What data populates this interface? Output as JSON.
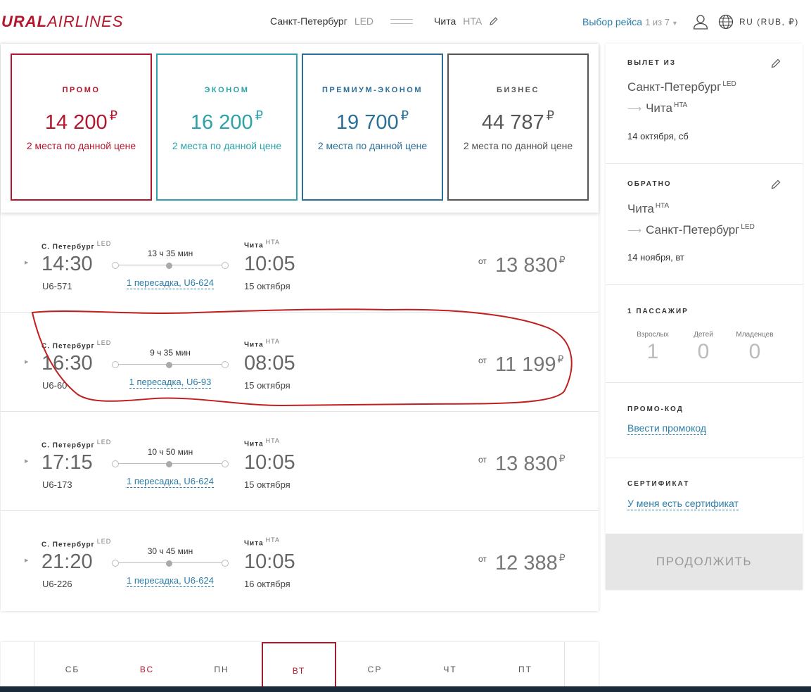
{
  "header": {
    "logo_bold": "URAL",
    "logo_light": "AIRLINES",
    "from_city": "Санкт-Петербург",
    "from_code": "LED",
    "to_city": "Чита",
    "to_code": "HTA",
    "step_label": "Выбор рейса",
    "step_count": "1 из 7",
    "language": "RU (RUB, ₽)"
  },
  "fares": [
    {
      "name": "ПРОМО",
      "price": "14 200",
      "currency": "₽",
      "seats": "2 места по данной цене",
      "color": "#b3172d"
    },
    {
      "name": "ЭКОНОМ",
      "price": "16 200",
      "currency": "₽",
      "seats": "2 места по данной цене",
      "color": "#2da3a9"
    },
    {
      "name": "ПРЕМИУМ-ЭКОНОМ",
      "price": "19 700",
      "currency": "₽",
      "seats": "2 места по данной цене",
      "color": "#2a6f98"
    },
    {
      "name": "БИЗНЕС",
      "price": "44 787",
      "currency": "₽",
      "seats": "2 места по данной цене",
      "color": "#555555"
    }
  ],
  "flights": [
    {
      "from": "С. Петербург",
      "from_code": "LED",
      "dep": "14:30",
      "number": "U6-571",
      "duration": "13 ч 35 мин",
      "transfer": "1 пересадка, U6-624",
      "to": "Чита",
      "to_code": "HTA",
      "arr": "10:05",
      "arr_date": "15 октября",
      "from_label": "от",
      "price": "13 830",
      "currency": "₽"
    },
    {
      "from": "С. Петербург",
      "from_code": "LED",
      "dep": "16:30",
      "number": "U6-60",
      "duration": "9 ч 35 мин",
      "transfer": "1 пересадка, U6-93",
      "to": "Чита",
      "to_code": "HTA",
      "arr": "08:05",
      "arr_date": "15 октября",
      "from_label": "от",
      "price": "11 199",
      "currency": "₽"
    },
    {
      "from": "С. Петербург",
      "from_code": "LED",
      "dep": "17:15",
      "number": "U6-173",
      "duration": "10 ч 50 мин",
      "transfer": "1 пересадка, U6-624",
      "to": "Чита",
      "to_code": "HTA",
      "arr": "10:05",
      "arr_date": "15 октября",
      "from_label": "от",
      "price": "13 830",
      "currency": "₽"
    },
    {
      "from": "С. Петербург",
      "from_code": "LED",
      "dep": "21:20",
      "number": "U6-226",
      "duration": "30 ч 45 мин",
      "transfer": "1 пересадка, U6-624",
      "to": "Чита",
      "to_code": "HTA",
      "arr": "10:05",
      "arr_date": "16 октября",
      "from_label": "от",
      "price": "12 388",
      "currency": "₽"
    }
  ],
  "sidebar": {
    "depart": {
      "title": "ВЫЛЕТ ИЗ",
      "from": "Санкт-Петербург",
      "from_code": "LED",
      "to": "Чита",
      "to_code": "HTA",
      "date": "14 октября, сб"
    },
    "return": {
      "title": "ОБРАТНО",
      "from": "Чита",
      "from_code": "HTA",
      "to": "Санкт-Петербург",
      "to_code": "LED",
      "date": "14 ноября, вт"
    },
    "passengers": {
      "title": "1 ПАССАЖИР",
      "items": [
        {
          "label": "Взрослых",
          "value": "1"
        },
        {
          "label": "Детей",
          "value": "0"
        },
        {
          "label": "Младенцев",
          "value": "0"
        }
      ]
    },
    "promo": {
      "title": "ПРОМО-КОД",
      "link": "Ввести промокод"
    },
    "certificate": {
      "title": "СЕРТИФИКАТ",
      "link": "У меня есть сертификат"
    },
    "continue_label": "ПРОДОЛЖИТЬ"
  },
  "date_strip": {
    "days": [
      {
        "name": "СБ",
        "weekend": false
      },
      {
        "name": "ВС",
        "weekend": true
      },
      {
        "name": "ПН",
        "weekend": false
      },
      {
        "name": "ВТ",
        "weekend": false,
        "selected": true
      },
      {
        "name": "СР",
        "weekend": false
      },
      {
        "name": "ЧТ",
        "weekend": false
      },
      {
        "name": "ПТ",
        "weekend": false
      }
    ]
  },
  "colors": {
    "brand": "#b3172d",
    "link": "#2c7ea8",
    "annotation": "#b01c1c"
  }
}
